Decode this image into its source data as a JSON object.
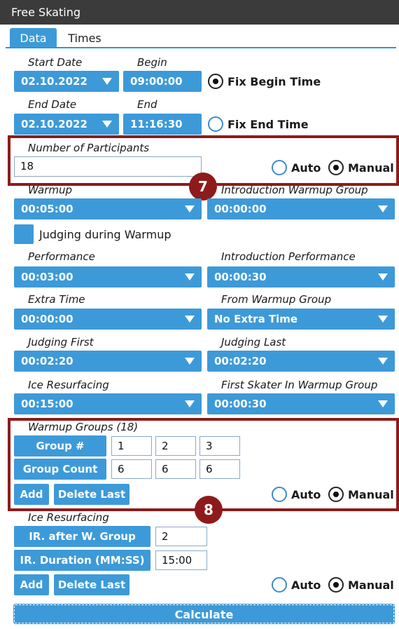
{
  "window": {
    "title": "Free Skating"
  },
  "tabs": [
    {
      "label": "Data",
      "active": true
    },
    {
      "label": "Times",
      "active": false
    }
  ],
  "dates": {
    "start_date_label": "Start Date",
    "start_date": "02.10.2022",
    "begin_label": "Begin",
    "begin": "09:00:00",
    "fix_begin_label": "Fix Begin Time",
    "fix_begin_selected": true,
    "end_date_label": "End Date",
    "end_date": "02.10.2022",
    "end_label": "End",
    "end": "11:16:30",
    "fix_end_label": "Fix End Time",
    "fix_end_selected": false
  },
  "participants": {
    "label": "Number of Participants",
    "value": "18",
    "auto_label": "Auto",
    "manual_label": "Manual",
    "mode": "Manual"
  },
  "warmup": {
    "label": "Warmup",
    "value": "00:05:00",
    "intro_label": "Introduction Warmup Group",
    "intro_value": "00:00:00",
    "judging_label": "Judging during Warmup"
  },
  "performance": {
    "label": "Performance",
    "value": "00:03:00",
    "intro_label": "Introduction Performance",
    "intro_value": "00:00:30"
  },
  "extra": {
    "label": "Extra Time",
    "value": "00:00:00",
    "from_label": "From Warmup Group",
    "from_value": "No Extra Time"
  },
  "judging": {
    "first_label": "Judging First",
    "first_value": "00:02:20",
    "last_label": "Judging Last",
    "last_value": "00:02:20"
  },
  "ice": {
    "label": "Ice Resurfacing",
    "value": "00:15:00",
    "first_skater_label": "First Skater In Warmup Group",
    "first_skater_value": "00:00:30"
  },
  "warmup_groups": {
    "label": "Warmup Groups (18)",
    "group_num_label": "Group #",
    "group_nums": [
      "1",
      "2",
      "3"
    ],
    "group_count_label": "Group Count",
    "group_counts": [
      "6",
      "6",
      "6"
    ],
    "add_label": "Add",
    "delete_label": "Delete Last",
    "auto_label": "Auto",
    "manual_label": "Manual",
    "mode": "Manual"
  },
  "ice_resurfacing": {
    "label": "Ice Resurfacing",
    "after_label": "IR. after W. Group",
    "after_value": "2",
    "duration_label": "IR. Duration (MM:SS)",
    "duration_value": "15:00",
    "add_label": "Add",
    "delete_label": "Delete Last",
    "auto_label": "Auto",
    "manual_label": "Manual",
    "mode": "Manual"
  },
  "calculate_label": "Calculate",
  "callouts": {
    "first": "7",
    "second": "8"
  },
  "colors": {
    "accent": "#3d9ad8",
    "callout": "#8e1b1b",
    "titlebar": "#3b3b3b"
  }
}
